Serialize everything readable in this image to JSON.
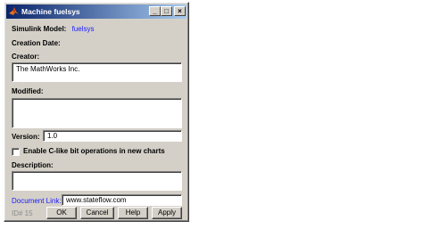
{
  "window": {
    "title": "Machine fuelsys"
  },
  "titlebar_buttons": {
    "minimize": "_",
    "maximize": "□",
    "close": "×"
  },
  "simulink_model": {
    "label": "Simulink Model:",
    "value": "fuelsys"
  },
  "creation_date": {
    "label": "Creation Date:"
  },
  "creator": {
    "label": "Creator:",
    "value": "The MathWorks Inc."
  },
  "modified": {
    "label": "Modified:",
    "value": ""
  },
  "version": {
    "label": "Version:",
    "value": "1.0"
  },
  "c_bit_ops": {
    "label": "Enable C-like bit operations in new charts",
    "checked": false
  },
  "description": {
    "label": "Description:",
    "value": ""
  },
  "document_link": {
    "label": "Document Link:",
    "value": "www.stateflow.com"
  },
  "id_text": "ID# 15",
  "buttons": {
    "ok": "OK",
    "cancel": "Cancel",
    "help": "Help",
    "apply": "Apply"
  },
  "colors": {
    "titlebar_start": "#0a246a",
    "titlebar_end": "#a6caf0",
    "link": "#1a1aff",
    "face": "#d4d0c8"
  },
  "icons": {
    "window_icon": "matlab-logo-icon"
  }
}
